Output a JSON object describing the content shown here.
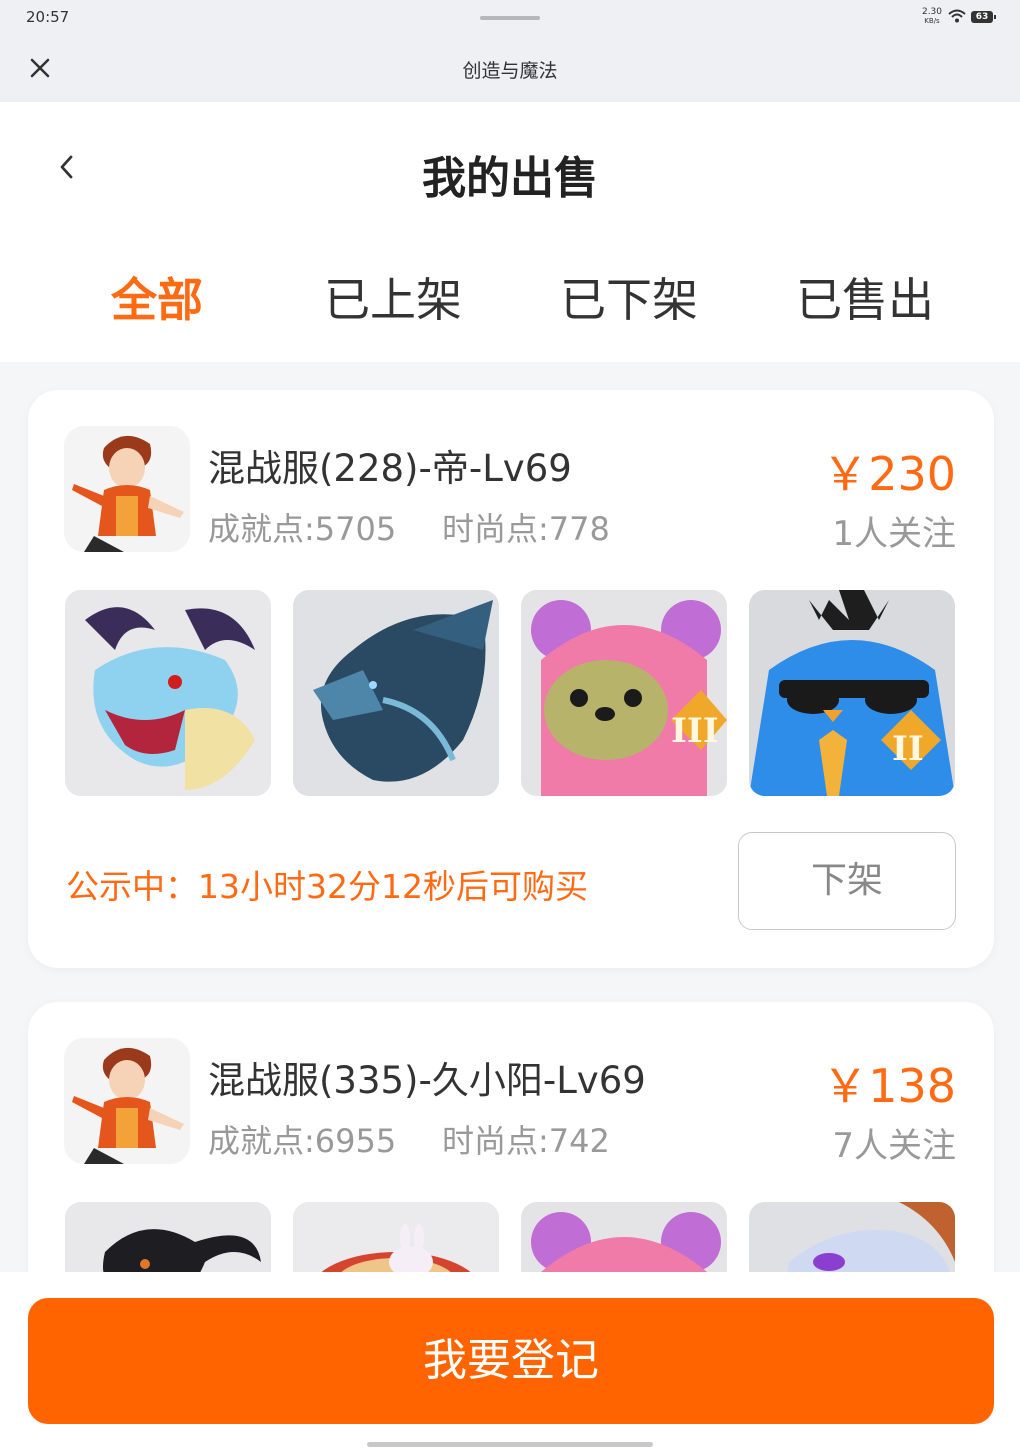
{
  "status_bar": {
    "time": "20:57",
    "speed_value": "2.30",
    "speed_unit": "KB/s",
    "battery": "63"
  },
  "titlebar": {
    "app_title": "创造与魔法"
  },
  "header": {
    "page_title": "我的出售",
    "tabs": [
      {
        "label": "全部",
        "active": true
      },
      {
        "label": "已上架",
        "active": false
      },
      {
        "label": "已下架",
        "active": false
      },
      {
        "label": "已售出",
        "active": false
      }
    ]
  },
  "listings": [
    {
      "title": "混战服(228)-帝-Lv69",
      "achievement": "成就点:5705",
      "fashion": "时尚点:778",
      "price": "￥230",
      "followers": "1人关注",
      "thumbs": [
        "dragon-light-blue",
        "dragon-dark-blue",
        "pink-bear-III",
        "blue-bird-II"
      ],
      "notice": "公示中：13小时32分12秒后可购买",
      "offshelf_label": "下架"
    },
    {
      "title": "混战服(335)-久小阳-Lv69",
      "achievement": "成就点:6955",
      "fashion": "时尚点:742",
      "price": "￥138",
      "followers": "7人关注",
      "thumbs": [
        "black-goat",
        "rabbit-nest",
        "pink-bear",
        "white-dragon"
      ]
    }
  ],
  "bottom": {
    "register_label": "我要登记"
  },
  "colors": {
    "accent": "#ff6a13",
    "button": "#ff6400",
    "muted": "#999999"
  }
}
